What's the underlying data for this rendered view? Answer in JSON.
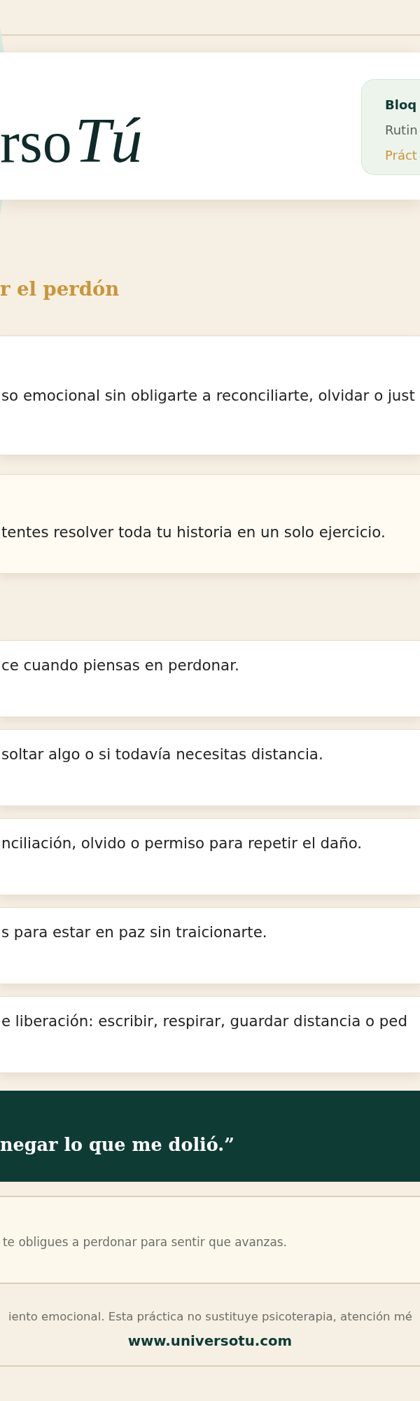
{
  "header": {
    "logo": {
      "wordmark": "rso",
      "script": "Tú"
    },
    "badge": {
      "title": "Bloq",
      "subtitle": "Rutin",
      "label": "Práct"
    }
  },
  "section_title": "r el perdón",
  "intro": {
    "text": "so emocional sin obligarte a reconciliarte, olvidar o just"
  },
  "tip": {
    "text": "tentes resolver toda tu historia en un solo ejercicio."
  },
  "steps": [
    {
      "text": "ce cuando piensas en perdonar."
    },
    {
      "text": "soltar algo o si todavía necesitas distancia."
    },
    {
      "text": "nciliación, olvido o permiso para repetir el daño."
    },
    {
      "text": "s para estar en paz sin traicionarte."
    },
    {
      "text": "e liberación: escribir, respirar, guardar distancia o ped"
    }
  ],
  "quote": {
    "text": "negar lo que me dolió.”"
  },
  "note": {
    "text": "te obligues a perdonar para sentir que avanzas."
  },
  "footer": {
    "disclaimer": "iento emocional. Esta práctica no sustituye psicoterapia, atención mé",
    "url": "www.universotu.com"
  }
}
